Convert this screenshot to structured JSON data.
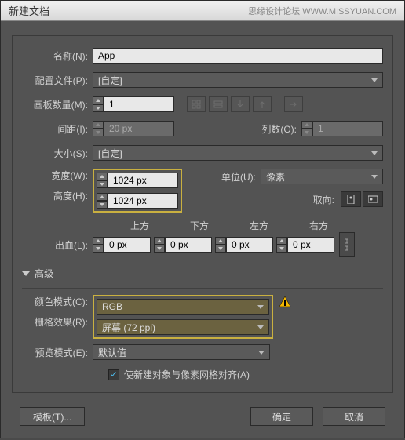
{
  "title": "新建文档",
  "watermark": "思缘设计论坛 WWW.MISSYUAN.COM",
  "labels": {
    "name": "名称(N):",
    "profile": "配置文件(P):",
    "artboards": "画板数量(M):",
    "spacing": "间距(I):",
    "columns": "列数(O):",
    "size": "大小(S):",
    "width": "宽度(W):",
    "height": "高度(H):",
    "units": "单位(U):",
    "orientation": "取向:",
    "bleed": "出血(L):",
    "top": "上方",
    "bottom": "下方",
    "left": "左方",
    "right": "右方",
    "advanced": "高级",
    "colormode": "颜色模式(C):",
    "raster": "栅格效果(R):",
    "preview": "预览模式(E):"
  },
  "values": {
    "name": "App",
    "profile": "[自定]",
    "artboards": "1",
    "spacing": "20 px",
    "columns": "1",
    "size": "[自定]",
    "width": "1024 px",
    "height": "1024 px",
    "units": "像素",
    "bleed_top": "0 px",
    "bleed_bottom": "0 px",
    "bleed_left": "0 px",
    "bleed_right": "0 px",
    "colormode": "RGB",
    "raster": "屏幕 (72 ppi)",
    "preview": "默认值"
  },
  "checkbox": {
    "align": "使新建对象与像素网格对齐(A)",
    "checked": true
  },
  "buttons": {
    "template": "模板(T)...",
    "ok": "确定",
    "cancel": "取消"
  }
}
